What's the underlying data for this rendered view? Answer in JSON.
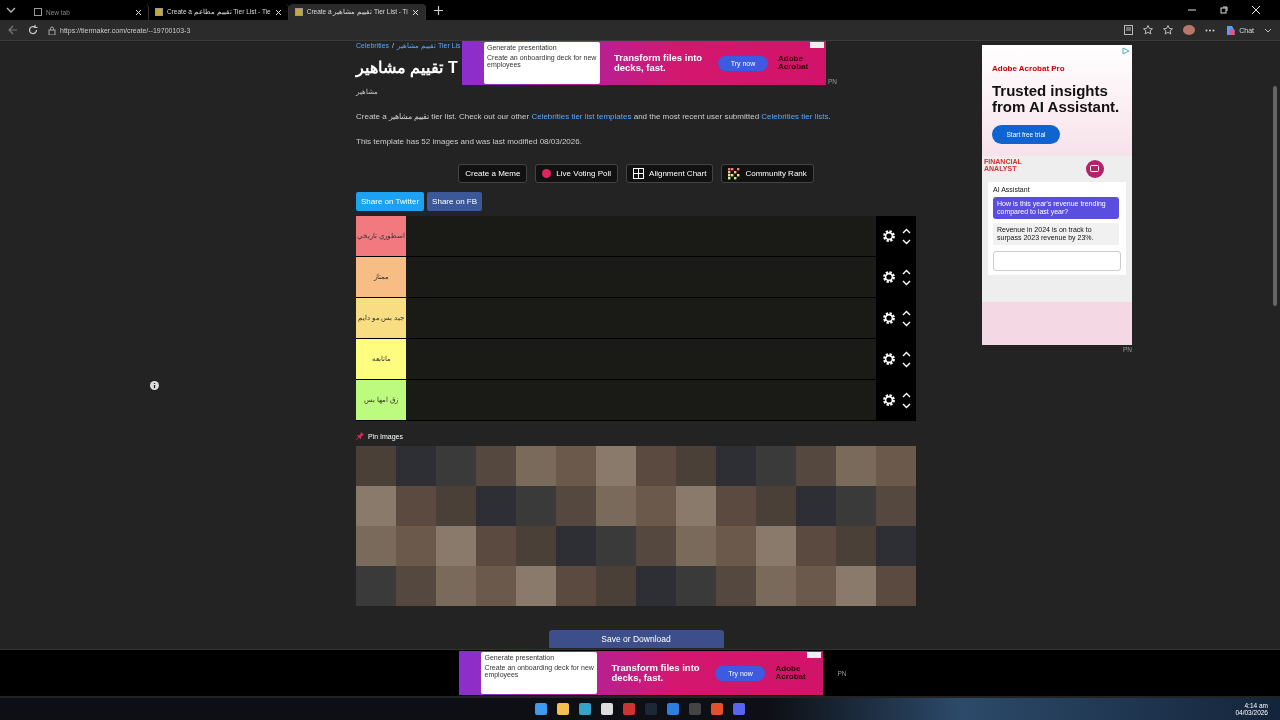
{
  "browser": {
    "tabs": [
      {
        "label": "New tab",
        "selected": false
      },
      {
        "label": "Create a تقييم مطاعم Tier List - Tie",
        "selected": false
      },
      {
        "label": "Create a تقييم مشاهير Tier List - Ti",
        "selected": true
      }
    ],
    "url": "https://tiermaker.com/create/--19700103-3",
    "chat_label": "Chat"
  },
  "page": {
    "breadcrumb": {
      "link": "Celebrities",
      "separator": "/",
      "current": "تقييم مشاهير Tier Lis"
    },
    "title": "تقييم مشاهير T",
    "category": "مشاهير",
    "description": {
      "before": "Create a تقييم مشاهير tier list. Check out our other",
      "link1": "Celebrities tier list templates",
      "middle": "and the most recent user submitted",
      "link2": "Celebrities tier lists",
      "after": "."
    },
    "info": "This template has 52 images and was last modified 08/03/2026.",
    "actions": [
      {
        "kind": "plain",
        "label": "Create a Meme"
      },
      {
        "kind": "dot",
        "label": "Live Voting Poll"
      },
      {
        "kind": "grid",
        "label": "Alignment Chart"
      },
      {
        "kind": "rank",
        "label": "Community Rank"
      }
    ],
    "share": [
      {
        "kind": "twitter",
        "label": "Share on Twitter"
      },
      {
        "kind": "facebook",
        "label": "Share on FB"
      }
    ],
    "tiers": [
      {
        "label": "اسطوري تاريخي",
        "color": "#f27a7f"
      },
      {
        "label": "ممتاز",
        "color": "#f7bd85"
      },
      {
        "label": "جيد بس مو دايم",
        "color": "#f8dd83"
      },
      {
        "label": "ماتابعه",
        "color": "#fffd7f"
      },
      {
        "label": "زق امها بس",
        "color": "#bdfb7f"
      }
    ],
    "pin_label": "Pin Images",
    "images": [
      {
        "kind": "photo"
      },
      {
        "kind": "photo"
      },
      {
        "kind": "photo"
      },
      {
        "kind": "photo"
      },
      {
        "kind": "photo"
      },
      {
        "kind": "photo"
      },
      {
        "kind": "photo"
      },
      {
        "kind": "photo"
      },
      {
        "kind": "photo"
      },
      {
        "kind": "photo"
      },
      {
        "kind": "photo"
      },
      {
        "kind": "photo"
      },
      {
        "kind": "photo"
      },
      {
        "kind": "photo"
      },
      {
        "kind": "photo"
      },
      {
        "kind": "photo"
      },
      {
        "kind": "photo"
      },
      {
        "kind": "photo"
      },
      {
        "kind": "photo"
      },
      {
        "kind": "photo"
      },
      {
        "kind": "photo"
      },
      {
        "kind": "photo"
      },
      {
        "kind": "photo"
      },
      {
        "kind": "photo"
      },
      {
        "kind": "photo"
      },
      {
        "kind": "photo"
      },
      {
        "kind": "photo"
      },
      {
        "kind": "photo"
      },
      {
        "kind": "photo"
      },
      {
        "kind": "photo"
      },
      {
        "kind": "photo"
      },
      {
        "kind": "photo"
      },
      {
        "kind": "photo"
      },
      {
        "kind": "photo"
      },
      {
        "kind": "photo"
      },
      {
        "kind": "photo"
      },
      {
        "kind": "photo"
      },
      {
        "kind": "photo"
      },
      {
        "kind": "photo"
      },
      {
        "kind": "photo"
      },
      {
        "kind": "photo"
      },
      {
        "kind": "photo"
      },
      {
        "kind": "photo"
      },
      {
        "kind": "photo"
      },
      {
        "kind": "photo"
      },
      {
        "kind": "photo"
      },
      {
        "kind": "photo"
      },
      {
        "kind": "photo"
      },
      {
        "kind": "photo"
      },
      {
        "kind": "photo"
      },
      {
        "kind": "photo"
      },
      {
        "kind": "photo"
      },
      {
        "kind": "photo"
      },
      {
        "kind": "photo"
      },
      {
        "kind": "photo"
      },
      {
        "kind": "photo"
      }
    ],
    "save_button": "Save or Download"
  },
  "top_ad": {
    "card_title": "Generate presentation",
    "card_text": "Create an onboarding deck for new employees",
    "headline": "Transform files into decks, fast.",
    "button": "Try now",
    "brand": "Adobe Acrobat",
    "tag": "PN"
  },
  "side_ad": {
    "brand": "Adobe Acrobat Pro",
    "headline": "Trusted insights from AI Assistant.",
    "button": "Start free trial",
    "doc_label": "FINANCIAL ANALYST",
    "assistant_title": "AI Assistant",
    "question": "How is this year's revenue trending compared to last year?",
    "answer": "Revenue in 2024 is on track to surpass 2023 revenue by 23%.",
    "tag": "PN"
  },
  "bottom_ad": {
    "card_title": "Generate presentation",
    "card_text": "Create an onboarding deck for new employees",
    "headline": "Transform files into decks, fast.",
    "button": "Try now",
    "brand": "Adobe Acrobat",
    "tag": "PN"
  },
  "taskbar": {
    "time": "4:14 am",
    "date": "04/03/2026"
  }
}
